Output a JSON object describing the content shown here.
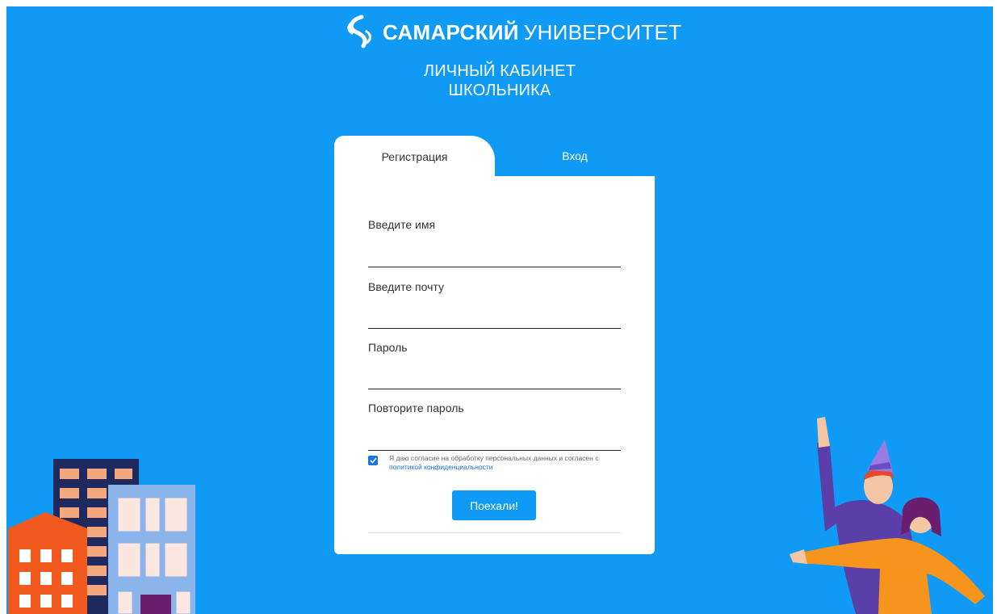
{
  "brand": {
    "name_bold": "САМАРСКИЙ",
    "name_light": "УНИВЕРСИТЕТ",
    "logo_icon": "samara-university-logo-icon"
  },
  "page": {
    "title_line1": "ЛИЧНЫЙ КАБИНЕТ",
    "title_line2": "ШКОЛЬНИКА"
  },
  "tabs": [
    {
      "label": "Регистрация",
      "active": true
    },
    {
      "label": "Вход",
      "active": false
    }
  ],
  "form": {
    "fields": [
      {
        "label": "Введите имя",
        "value": ""
      },
      {
        "label": "Введите почту",
        "value": ""
      },
      {
        "label": "Пароль",
        "value": ""
      },
      {
        "label": "Повторите пароль",
        "value": ""
      }
    ],
    "consent": {
      "checked": true,
      "text": "Я даю согласие на обработку персональных данных и согласен с",
      "link_text": "политикой конфиденциальности"
    },
    "submit_label": "Поехали!"
  },
  "colors": {
    "background": "#0f9bf5",
    "card": "#ffffff",
    "accent": "#1a73e8"
  }
}
